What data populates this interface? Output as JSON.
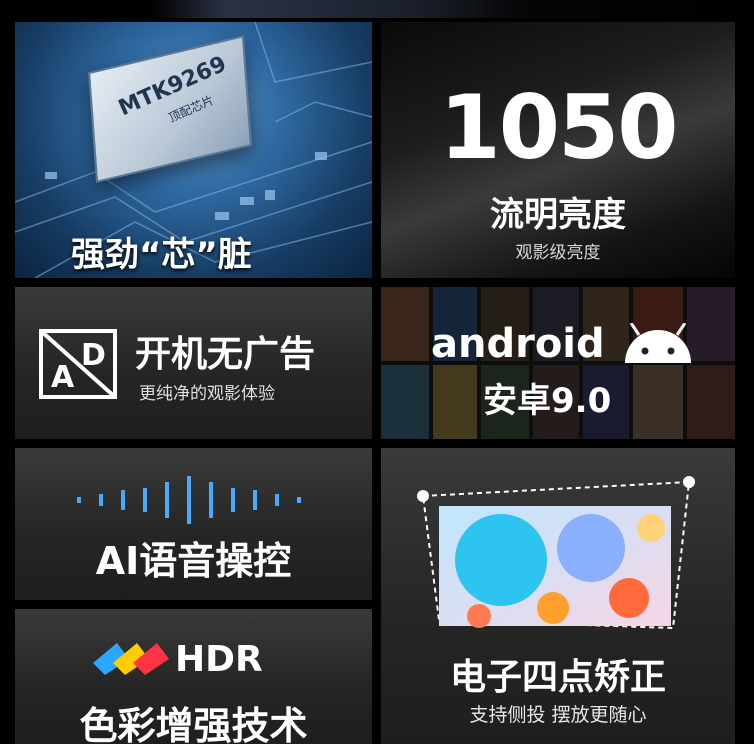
{
  "chip": {
    "model": "MTK9269",
    "model_sub": "顶配芯片",
    "caption": "强劲“芯”脏"
  },
  "brightness": {
    "value": "1050",
    "title": "流明亮度",
    "subtitle": "观影级亮度"
  },
  "no_ads": {
    "icon_letters": "AD",
    "title": "开机无广告",
    "subtitle": "更纯净的观影体验"
  },
  "android": {
    "word": "android",
    "version": "安卓9.0"
  },
  "voice": {
    "title": "AI语音操控"
  },
  "keystone": {
    "title": "电子四点矫正",
    "subtitle": "支持侧投  摆放更随心"
  },
  "hdr": {
    "logo_text": "HDR",
    "title": "色彩增强技术"
  },
  "colors": {
    "background": "#000000",
    "tile": "#2a2a2a",
    "chip_blue": "#2f6aa3",
    "android_white": "#ffffff"
  }
}
